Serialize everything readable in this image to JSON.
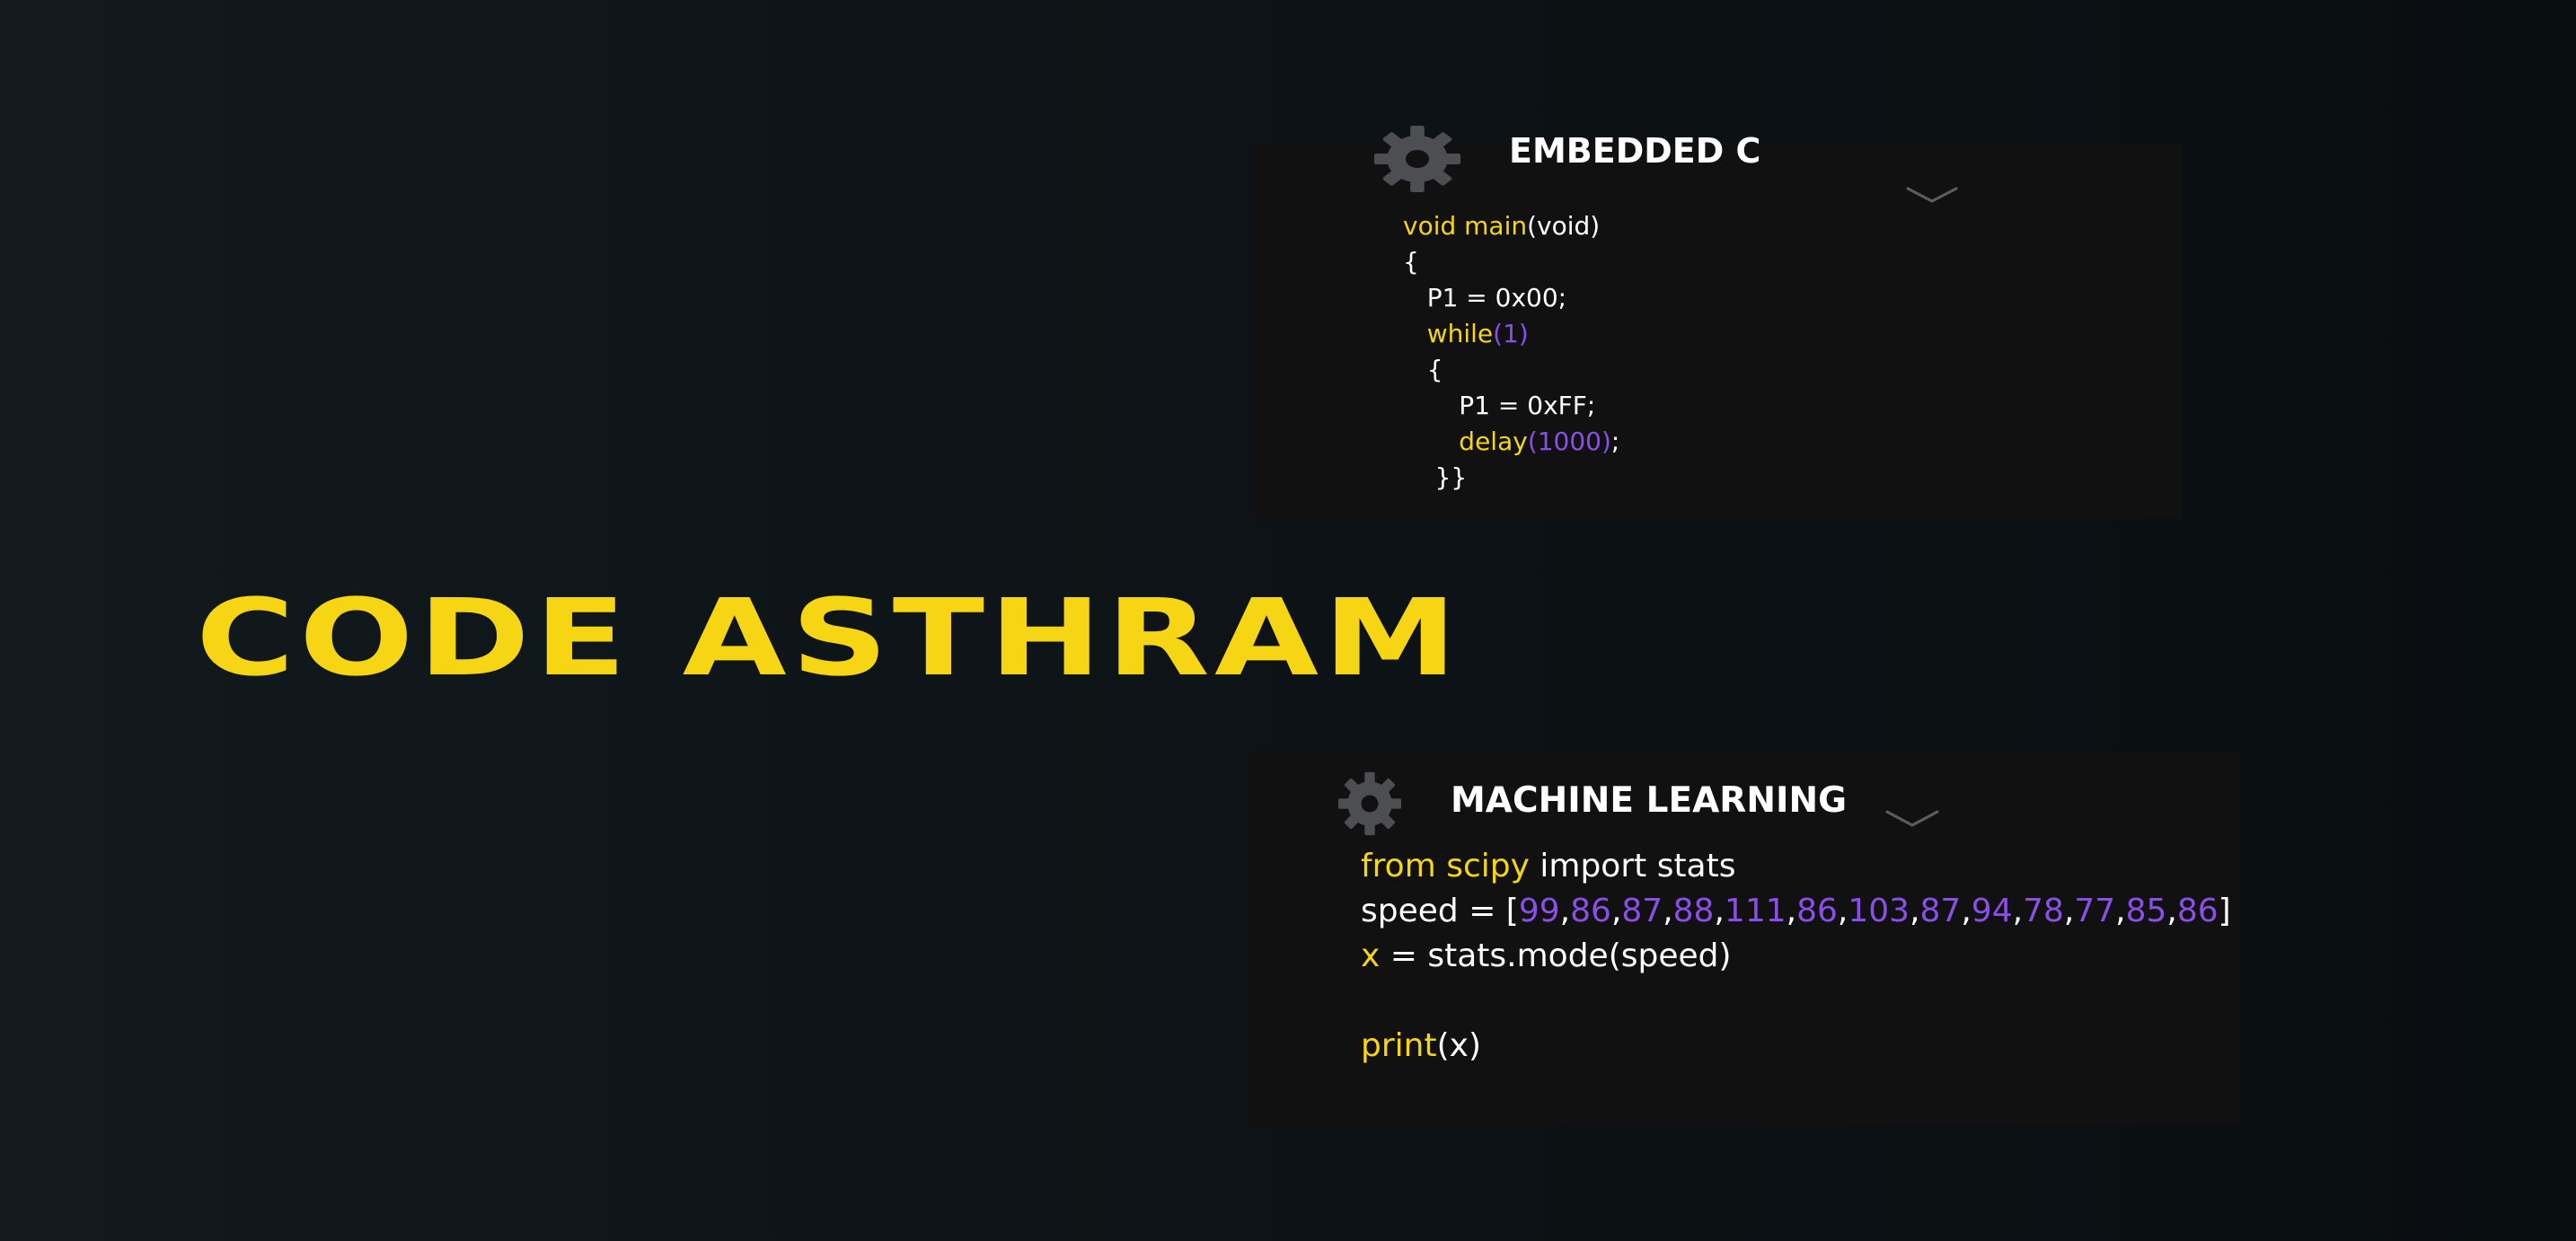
{
  "logo": {
    "text": "CODE ASTHRAM"
  },
  "colors": {
    "accent_yellow": "#f5d514",
    "number_purple": "#8a4fe6",
    "card_background": "#111111",
    "gear_gray": "#4c4e52"
  },
  "cards": [
    {
      "title": "EMBEDDED C",
      "icon": "gear-icon",
      "toggle_icon": "chevron-down-icon",
      "code_lines": [
        [
          {
            "t": "void main",
            "c": "kw"
          },
          {
            "t": "(void)",
            "c": ""
          }
        ],
        [
          {
            "t": "{",
            "c": ""
          }
        ],
        [
          {
            "t": "   P1 = 0x00;",
            "c": ""
          }
        ],
        [
          {
            "t": "   while",
            "c": "kw"
          },
          {
            "t": "(1)",
            "c": "num"
          }
        ],
        [
          {
            "t": "   {",
            "c": ""
          }
        ],
        [
          {
            "t": "       P1 = 0xFF;",
            "c": ""
          }
        ],
        [
          {
            "t": "       delay",
            "c": "kw"
          },
          {
            "t": "(1000)",
            "c": "num"
          },
          {
            "t": ";",
            "c": ""
          }
        ],
        [
          {
            "t": "    }}",
            "c": ""
          }
        ]
      ]
    },
    {
      "title": "MACHINE LEARNING",
      "icon": "gear-icon",
      "toggle_icon": "chevron-down-icon",
      "code_lines": [
        [
          {
            "t": "from scipy",
            "c": "kw"
          },
          {
            "t": " import stats",
            "c": ""
          }
        ],
        [
          {
            "t": "speed = [",
            "c": ""
          },
          {
            "t": "99",
            "c": "num"
          },
          {
            "t": ",",
            "c": ""
          },
          {
            "t": "86",
            "c": "num"
          },
          {
            "t": ",",
            "c": ""
          },
          {
            "t": "87",
            "c": "num"
          },
          {
            "t": ",",
            "c": ""
          },
          {
            "t": "88",
            "c": "num"
          },
          {
            "t": ",",
            "c": ""
          },
          {
            "t": "111",
            "c": "num"
          },
          {
            "t": ",",
            "c": ""
          },
          {
            "t": "86",
            "c": "num"
          },
          {
            "t": ",",
            "c": ""
          },
          {
            "t": "103",
            "c": "num"
          },
          {
            "t": ",",
            "c": ""
          },
          {
            "t": "87",
            "c": "num"
          },
          {
            "t": ",",
            "c": ""
          },
          {
            "t": "94",
            "c": "num"
          },
          {
            "t": ",",
            "c": ""
          },
          {
            "t": "78",
            "c": "num"
          },
          {
            "t": ",",
            "c": ""
          },
          {
            "t": "77",
            "c": "num"
          },
          {
            "t": ",",
            "c": ""
          },
          {
            "t": "85",
            "c": "num"
          },
          {
            "t": ",",
            "c": ""
          },
          {
            "t": "86",
            "c": "num"
          },
          {
            "t": "]",
            "c": ""
          }
        ],
        [
          {
            "t": "x",
            "c": "kw"
          },
          {
            "t": " = stats.mode(speed)",
            "c": ""
          }
        ],
        [],
        [
          {
            "t": "print",
            "c": "kw"
          },
          {
            "t": "(x)",
            "c": ""
          }
        ]
      ]
    }
  ]
}
